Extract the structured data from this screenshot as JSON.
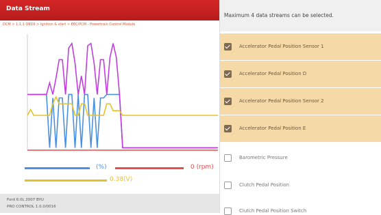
{
  "header": {
    "title": "Data Stream",
    "subtitle": "DCM > 1.1.1 OBDII > Ignition & start > EEC/PCM - Powertrain Control Module"
  },
  "legend": [
    {
      "value": "(%)",
      "color": "#4a90e2"
    },
    {
      "value": "0 (rpm)",
      "color": "#e84a4a"
    },
    {
      "value": "0.38(V)",
      "color": "#e6c229"
    }
  ],
  "status": {
    "line1": "Ford 6.0L 2007 BYU",
    "line2": "PRO CONTROL 1.0.0/0016"
  },
  "side": {
    "header": "Maximum 4 data streams can be selected.",
    "items": [
      {
        "label": "Accelerator Pedal Position Sensor 1",
        "checked": true
      },
      {
        "label": "Accelerator Pedal Position D",
        "checked": true
      },
      {
        "label": "Accelerator Pedal Position Sensor 2",
        "checked": true
      },
      {
        "label": "Accelerator Pedal Position E",
        "checked": true
      },
      {
        "label": "Barometric Pressure",
        "checked": false
      },
      {
        "label": "Clutch Pedal Position",
        "checked": false
      },
      {
        "label": "Clutch Pedal Position Switch",
        "checked": false
      }
    ]
  },
  "chart_data": {
    "type": "line",
    "title": "",
    "xlabel": "",
    "ylabel": "",
    "ylim": [
      0,
      100
    ],
    "x": [
      0,
      1,
      2,
      3,
      4,
      5,
      6,
      7,
      8,
      9,
      10,
      11,
      12,
      13,
      14,
      15,
      16,
      17,
      18,
      19,
      20,
      21,
      22,
      23,
      24,
      25,
      26,
      27,
      28,
      29,
      30,
      31,
      32,
      33,
      34,
      35,
      36,
      37,
      38,
      39,
      40,
      41,
      42,
      43,
      44,
      45,
      46,
      47,
      48,
      49,
      50,
      51,
      52,
      53,
      54,
      55,
      56,
      57,
      58,
      59,
      60
    ],
    "series": [
      {
        "color": "#4a90e2",
        "values": [
          48,
          48,
          48,
          48,
          48,
          48,
          48,
          2,
          45,
          2,
          45,
          45,
          2,
          48,
          48,
          2,
          48,
          2,
          48,
          48,
          2,
          45,
          2,
          45,
          45,
          48,
          48,
          48,
          48,
          48,
          2,
          2,
          2,
          2,
          2,
          2,
          2,
          2,
          2,
          2,
          2,
          2,
          2,
          2,
          2,
          2,
          2,
          2,
          2,
          2,
          2,
          2,
          2,
          2,
          2,
          2,
          2,
          2,
          2,
          2,
          2
        ]
      },
      {
        "color": "#c23de0",
        "values": [
          48,
          48,
          48,
          48,
          48,
          48,
          48,
          58,
          48,
          62,
          78,
          78,
          48,
          88,
          92,
          75,
          48,
          64,
          48,
          90,
          92,
          75,
          48,
          78,
          78,
          48,
          80,
          92,
          80,
          48,
          2,
          2,
          2,
          2,
          2,
          2,
          2,
          2,
          2,
          2,
          2,
          2,
          2,
          2,
          2,
          2,
          2,
          2,
          2,
          2,
          2,
          2,
          2,
          2,
          2,
          2,
          2,
          2,
          2,
          2,
          2
        ]
      },
      {
        "color": "#e6c229",
        "values": [
          30,
          35,
          30,
          30,
          30,
          30,
          30,
          30,
          40,
          46,
          40,
          40,
          40,
          40,
          40,
          30,
          30,
          40,
          40,
          30,
          30,
          30,
          30,
          30,
          30,
          40,
          40,
          34,
          34,
          34,
          30,
          30,
          30,
          30,
          30,
          30,
          30,
          30,
          30,
          30,
          30,
          30,
          30,
          30,
          30,
          30,
          30,
          30,
          30,
          30,
          30,
          30,
          30,
          30,
          30,
          30,
          30,
          30,
          30,
          30,
          30
        ]
      },
      {
        "color": "#e84a4a",
        "values": [
          0,
          0,
          0,
          0,
          0,
          0,
          0,
          0,
          0,
          0,
          0,
          0,
          0,
          0,
          0,
          0,
          0,
          0,
          0,
          0,
          0,
          0,
          0,
          0,
          0,
          0,
          0,
          0,
          0,
          0,
          0,
          0,
          0,
          0,
          0,
          0,
          0,
          0,
          0,
          0,
          0,
          0,
          0,
          0,
          0,
          0,
          0,
          0,
          0,
          0,
          0,
          0,
          0,
          0,
          0,
          0,
          0,
          0,
          0,
          0,
          0
        ]
      }
    ]
  }
}
